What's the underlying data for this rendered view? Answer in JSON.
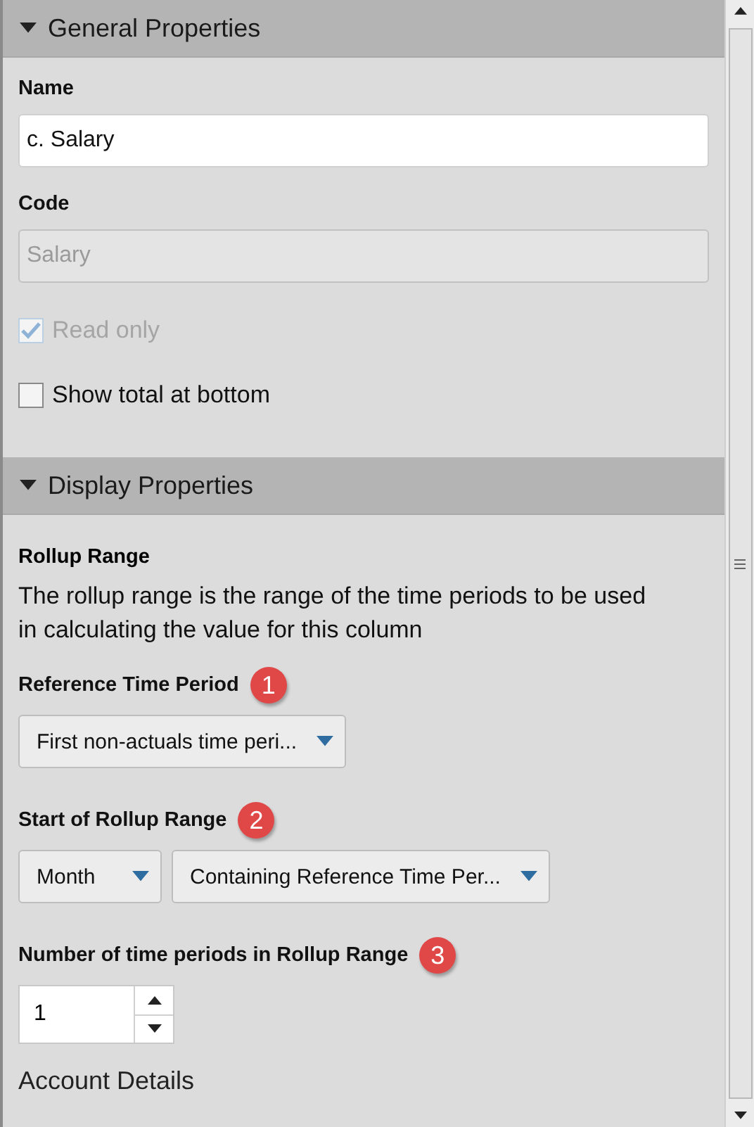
{
  "sections": [
    {
      "title": "General Properties",
      "expanded": true,
      "items": [
        {
          "kind": "text_input",
          "label": "Name",
          "value": "c. Salary",
          "disabled": false
        },
        {
          "kind": "text_input",
          "label": "Code",
          "value": "Salary",
          "disabled": true
        },
        {
          "kind": "checkbox",
          "label": "Read only",
          "checked": true,
          "disabled": true
        },
        {
          "kind": "checkbox",
          "label": "Show total at bottom",
          "checked": false,
          "disabled": false
        }
      ]
    },
    {
      "title": "Display Properties",
      "expanded": true,
      "items": [
        {
          "kind": "heading",
          "text": "Rollup Range"
        },
        {
          "kind": "paragraph",
          "text": "The rollup range is the range of the time periods to be used in calculating the value for this column"
        },
        {
          "kind": "selects",
          "label": "Reference Time Period",
          "badge": "1",
          "selects": [
            {
              "value": "First non-actuals time peri..."
            }
          ]
        },
        {
          "kind": "selects",
          "label": "Start of Rollup Range",
          "badge": "2",
          "selects": [
            {
              "value": "Month"
            },
            {
              "value": "Containing Reference Time Per..."
            }
          ]
        },
        {
          "kind": "spinner",
          "label": "Number of time periods in Rollup Range",
          "badge": "3",
          "value": "1"
        },
        {
          "kind": "subheading",
          "text": "Account Details"
        }
      ]
    }
  ]
}
